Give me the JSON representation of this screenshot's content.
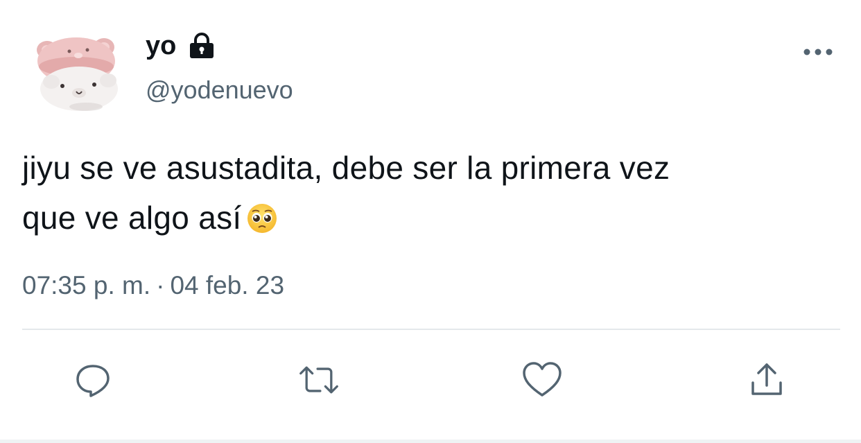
{
  "tweet": {
    "display_name": "yo",
    "handle": "@yodenuevo",
    "text_line1": "jiyu se ve asustadita, debe ser la primera vez",
    "text_line2": "que ve algo así",
    "time": "07:35 p. m.",
    "separator": "·",
    "date": "04 feb. 23"
  },
  "icons": {
    "lock": "lock-icon",
    "more": "more-horizontal-icon",
    "emoji": "pleading-face-emoji",
    "reply": "reply-icon",
    "retweet": "retweet-icon",
    "like": "heart-icon",
    "share": "share-icon"
  },
  "colors": {
    "text": "#0f1419",
    "secondary": "#536471",
    "divider": "#e4e8eb"
  }
}
